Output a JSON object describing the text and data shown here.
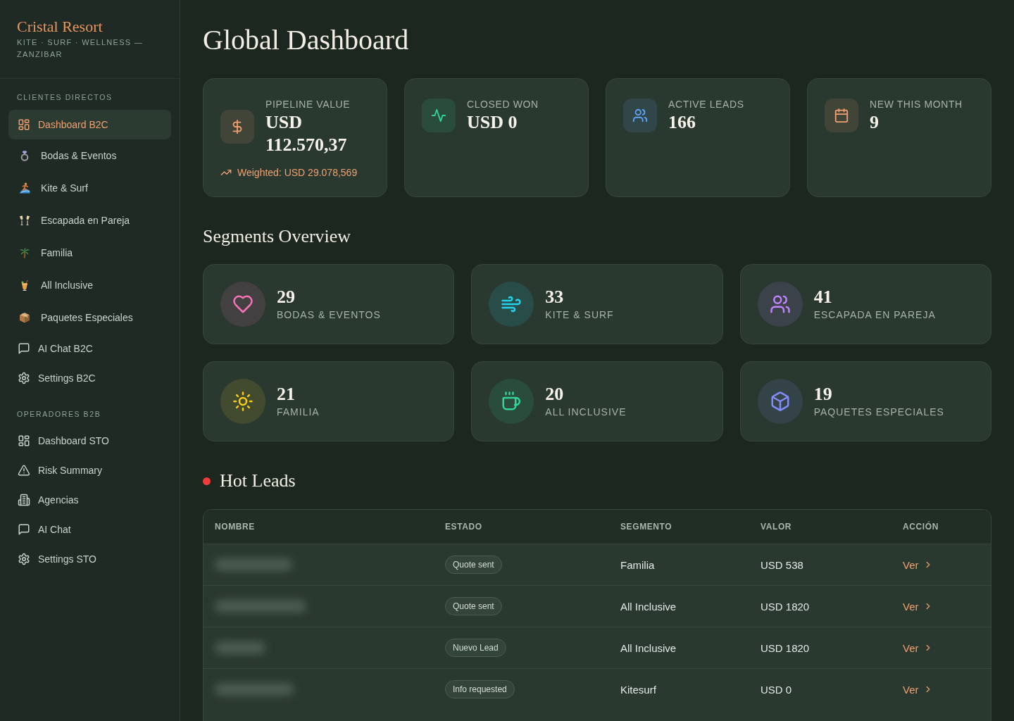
{
  "sidebar": {
    "brand": "Cristal Resort",
    "tagline": "KITE · SURF · WELLNESS — ZANZIBAR",
    "sections": [
      {
        "title": "CLIENTES DIRECTOS",
        "items": [
          {
            "label": "Dashboard B2C",
            "kind": "icon",
            "selected": true
          },
          {
            "label": "Bodas & Eventos",
            "kind": "emoji",
            "selected": false
          },
          {
            "label": "Kite & Surf",
            "kind": "emoji",
            "selected": false
          },
          {
            "label": "Escapada en Pareja",
            "kind": "emoji",
            "selected": false
          },
          {
            "label": "Familia",
            "kind": "emoji",
            "selected": false
          },
          {
            "label": "All Inclusive",
            "kind": "emoji",
            "selected": false
          },
          {
            "label": "Paquetes Especiales",
            "kind": "emoji",
            "selected": false
          },
          {
            "label": "AI Chat B2C",
            "kind": "icon",
            "selected": false
          },
          {
            "label": "Settings B2C",
            "kind": "icon",
            "selected": false
          }
        ]
      },
      {
        "title": "OPERADORES B2B",
        "items": [
          {
            "label": "Dashboard STO",
            "kind": "icon",
            "selected": false
          },
          {
            "label": "Risk Summary",
            "kind": "icon",
            "selected": false
          },
          {
            "label": "Agencias",
            "kind": "icon",
            "selected": false
          },
          {
            "label": "AI Chat",
            "kind": "icon",
            "selected": false
          },
          {
            "label": "Settings STO",
            "kind": "icon",
            "selected": false
          }
        ]
      }
    ]
  },
  "title": "Global Dashboard",
  "stats": [
    {
      "label": "PIPELINE VALUE",
      "value": "USD 112.570,37",
      "color": "#f0a070",
      "note": "Weighted: USD 29.078,569"
    },
    {
      "label": "CLOSED WON",
      "value": "USD 0",
      "color": "#34d399"
    },
    {
      "label": "ACTIVE LEADS",
      "value": "166",
      "color": "#60a5fa"
    },
    {
      "label": "NEW THIS MONTH",
      "value": "9",
      "color": "#f0a070"
    }
  ],
  "segments": {
    "title": "Segments Overview",
    "items": [
      {
        "count": "29",
        "label": "BODAS & EVENTOS",
        "color": "#f472b6"
      },
      {
        "count": "33",
        "label": "KITE & SURF",
        "color": "#22d3ee"
      },
      {
        "count": "41",
        "label": "ESCAPADA EN PAREJA",
        "color": "#c084fc"
      },
      {
        "count": "21",
        "label": "FAMILIA",
        "color": "#facc15"
      },
      {
        "count": "20",
        "label": "ALL INCLUSIVE",
        "color": "#34d399"
      },
      {
        "count": "19",
        "label": "PAQUETES ESPECIALES",
        "color": "#818cf8"
      }
    ]
  },
  "hot_leads": {
    "title": "Hot Leads",
    "columns": [
      "NOMBRE",
      "ESTADO",
      "SEGMENTO",
      "VALOR",
      "ACCIÓN"
    ],
    "rows": [
      {
        "status": "Quote sent",
        "segment": "Familia",
        "value": "USD 538",
        "action": "Ver"
      },
      {
        "status": "Quote sent",
        "segment": "All Inclusive",
        "value": "USD 1820",
        "action": "Ver"
      },
      {
        "status": "Nuevo Lead",
        "segment": "All Inclusive",
        "value": "USD 1820",
        "action": "Ver"
      },
      {
        "status": "Info requested",
        "segment": "Kitesurf",
        "value": "USD 0",
        "action": "Ver"
      }
    ]
  }
}
